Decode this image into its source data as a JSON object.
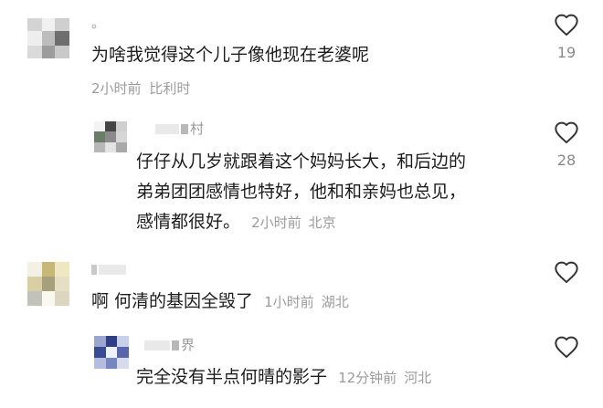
{
  "comments": [
    {
      "name_suffix": "。",
      "text": "为啥我觉得这个儿子像他现在老婆呢",
      "time": "2小时前",
      "location": "比利时",
      "likes": "19"
    },
    {
      "name_suffix": "村",
      "text_lines": [
        "仔仔从几岁就跟着这个妈妈长大，和后边的",
        "弟弟团团感情也特好，他和和亲妈也总见，",
        "感情都很好。"
      ],
      "time": "2小时前",
      "location": "北京",
      "likes": "28"
    },
    {
      "name_suffix": "",
      "text": "啊 何清的基因全毁了",
      "time": "1小时前",
      "location": "湖北"
    },
    {
      "name_suffix": "界",
      "text": "完全没有半点何晴的影子",
      "time": "12分钟前",
      "location": "河北"
    }
  ],
  "icons": {
    "like": "heart-outline-icon"
  },
  "colors": {
    "meta": "#9b9b9b",
    "text": "#1c1c1c",
    "icon": "#333333"
  }
}
